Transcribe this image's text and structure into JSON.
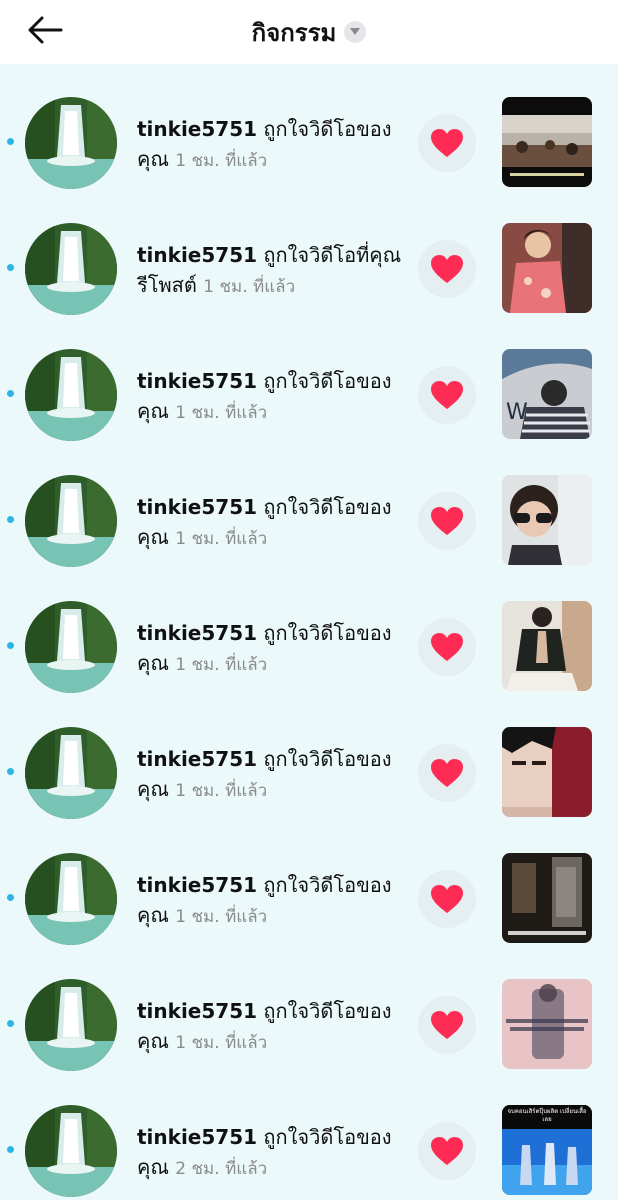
{
  "header": {
    "title": "กิจกรรม",
    "back_icon": "arrow-left-icon",
    "dropdown_icon": "caret-down-icon"
  },
  "activities": [
    {
      "username": "tinkie5751",
      "action": "ถูกใจวิดีโอของคุณ",
      "time": "1 ชม. ที่แล้ว",
      "thumb_caption": ""
    },
    {
      "username": "tinkie5751",
      "action": "ถูกใจวิดีโอที่คุณรีโพสต์",
      "time": "1 ชม. ที่แล้ว",
      "thumb_caption": ""
    },
    {
      "username": "tinkie5751",
      "action": "ถูกใจวิดีโอของคุณ",
      "time": "1 ชม. ที่แล้ว",
      "thumb_caption": ""
    },
    {
      "username": "tinkie5751",
      "action": "ถูกใจวิดีโอของคุณ",
      "time": "1 ชม. ที่แล้ว",
      "thumb_caption": ""
    },
    {
      "username": "tinkie5751",
      "action": "ถูกใจวิดีโอของคุณ",
      "time": "1 ชม. ที่แล้ว",
      "thumb_caption": ""
    },
    {
      "username": "tinkie5751",
      "action": "ถูกใจวิดีโอของคุณ",
      "time": "1 ชม. ที่แล้ว",
      "thumb_caption": ""
    },
    {
      "username": "tinkie5751",
      "action": "ถูกใจวิดีโอของคุณ",
      "time": "1 ชม. ที่แล้ว",
      "thumb_caption": ""
    },
    {
      "username": "tinkie5751",
      "action": "ถูกใจวิดีโอของคุณ",
      "time": "1 ชม. ที่แล้ว",
      "thumb_caption": ""
    },
    {
      "username": "tinkie5751",
      "action": "ถูกใจวิดีโอของคุณ",
      "time": "2 ชม. ที่แล้ว",
      "thumb_caption": "จบคอนเสิร์ตปุ๊บผลิต เปลี่ยนเสื้อเลย"
    }
  ],
  "colors": {
    "unread_dot": "#2bb7e6",
    "heart": "#fe2c55",
    "background": "#ecf9fb"
  }
}
